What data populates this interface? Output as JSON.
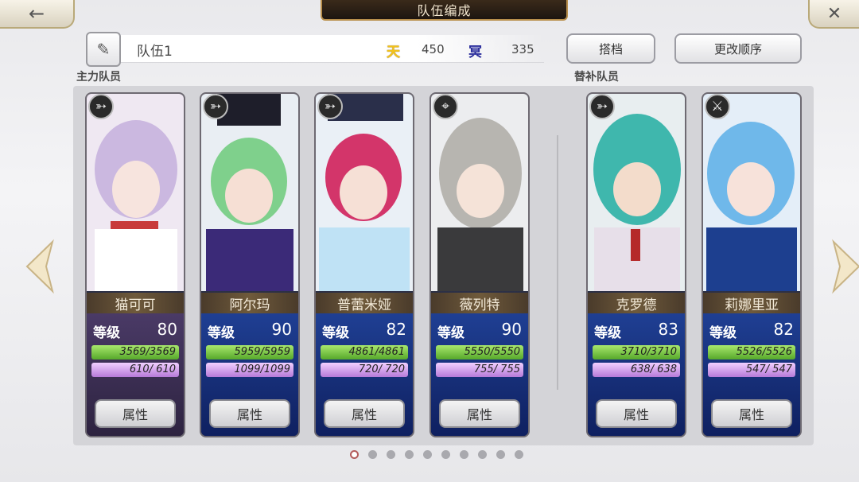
{
  "header": {
    "title": "队伍编成",
    "back_icon": "back-arrow-icon",
    "close_icon": "close-icon"
  },
  "team": {
    "name": "队伍1",
    "tian_label": "天",
    "tian_value": "450",
    "ming_label": "冥",
    "ming_value": "335"
  },
  "buttons": {
    "partner": "搭档",
    "change_order": "更改顺序"
  },
  "sections": {
    "main": "主力队员",
    "sub": "替补队员"
  },
  "cards": [
    {
      "name": "猫可可",
      "level_label": "等级",
      "level": "80",
      "hp": "3569/3569",
      "mp": "610/ 610",
      "attr": "属性",
      "class_icon": "bow-icon",
      "theme": "purple"
    },
    {
      "name": "阿尔玛",
      "level_label": "等级",
      "level": "90",
      "hp": "5959/5959",
      "mp": "1099/1099",
      "attr": "属性",
      "class_icon": "bow-icon",
      "theme": "blue"
    },
    {
      "name": "普蕾米娅",
      "level_label": "等级",
      "level": "82",
      "hp": "4861/4861",
      "mp": "720/ 720",
      "attr": "属性",
      "class_icon": "bow-icon",
      "theme": "blue"
    },
    {
      "name": "薇列特",
      "level_label": "等级",
      "level": "90",
      "hp": "5550/5550",
      "mp": "755/ 755",
      "attr": "属性",
      "class_icon": "gun-icon",
      "theme": "blue"
    },
    {
      "name": "克罗德",
      "level_label": "等级",
      "level": "83",
      "hp": "3710/3710",
      "mp": "638/ 638",
      "attr": "属性",
      "class_icon": "bow-icon",
      "theme": "blue"
    },
    {
      "name": "莉娜里亚",
      "level_label": "等级",
      "level": "82",
      "hp": "5526/5526",
      "mp": "547/ 547",
      "attr": "属性",
      "class_icon": "sword-icon",
      "theme": "blue"
    }
  ],
  "pagination": {
    "total": 10,
    "active": 0
  },
  "colors": {
    "hp_green": "#56a82a",
    "mp_purple": "#b67ad9",
    "tian_gold": "#f3c21b",
    "ming_blue": "#2a2d9c"
  }
}
